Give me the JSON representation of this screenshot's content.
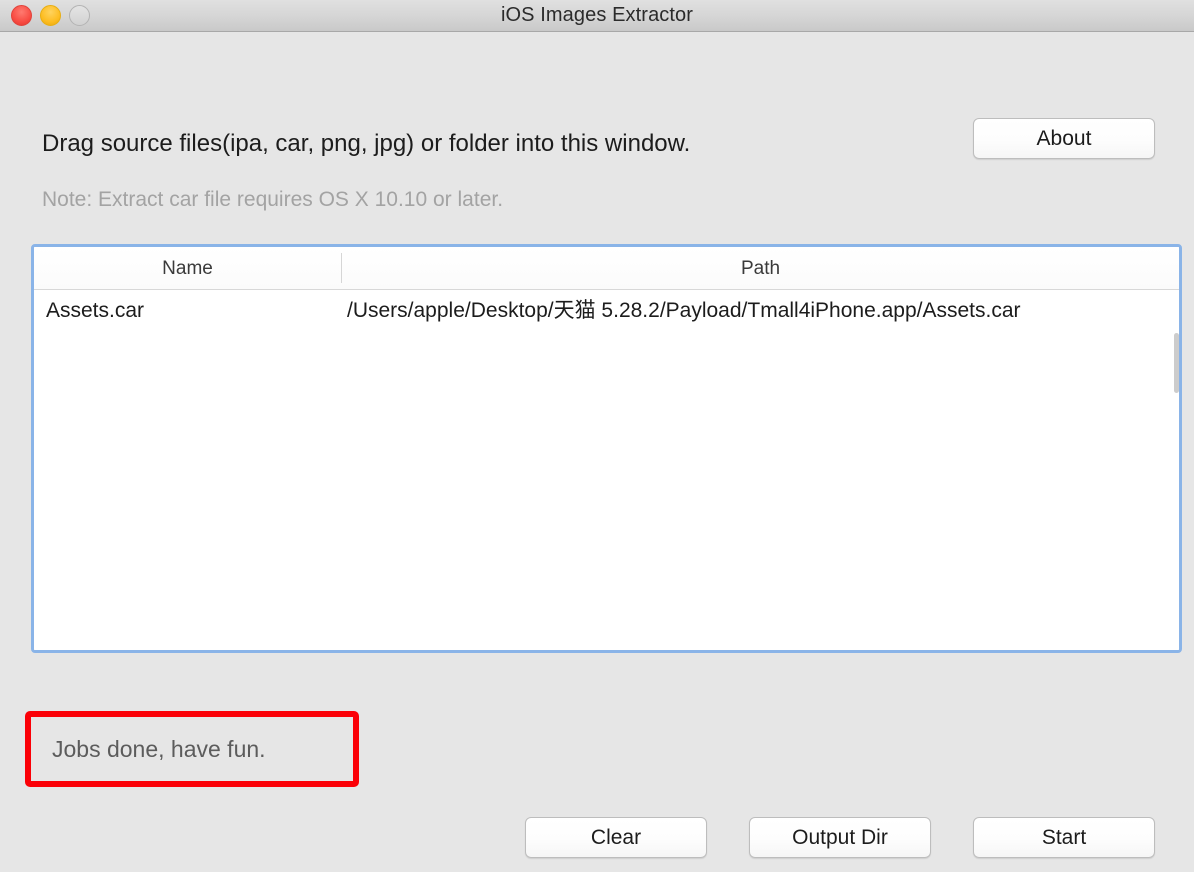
{
  "window": {
    "title": "iOS Images Extractor",
    "traffic_lights": [
      {
        "name": "close",
        "color": "#f84b42"
      },
      {
        "name": "minimize",
        "color": "#fdbc20"
      },
      {
        "name": "zoom",
        "color": "#d2d2d2"
      }
    ]
  },
  "main": {
    "headline": "Drag source files(ipa, car, png, jpg) or folder into this window.",
    "note": "Note: Extract car file requires OS X 10.10 or later.",
    "about_label": "About"
  },
  "table": {
    "columns": [
      {
        "key": "name",
        "header": "Name"
      },
      {
        "key": "path",
        "header": "Path"
      }
    ],
    "rows": [
      {
        "name": "Assets.car",
        "path": "/Users/apple/Desktop/天猫 5.28.2/Payload/Tmall4iPhone.app/Assets.car"
      }
    ],
    "focus_ring_color": "#8ab4e8"
  },
  "status": {
    "message": "Jobs done, have fun.",
    "annotation_color": "#fb0007"
  },
  "footer": {
    "clear_label": "Clear",
    "output_dir_label": "Output Dir",
    "start_label": "Start"
  }
}
